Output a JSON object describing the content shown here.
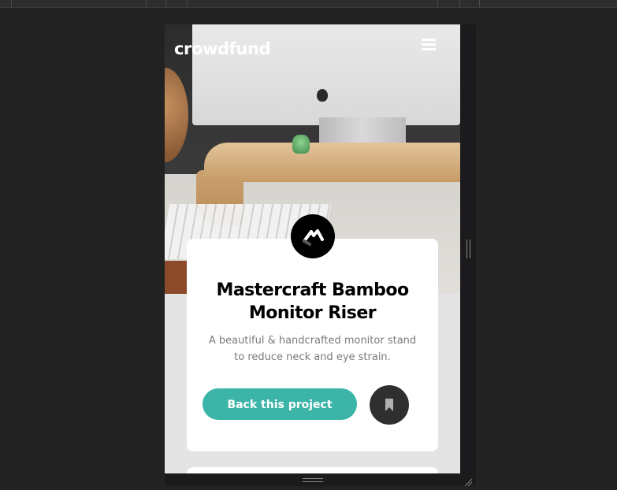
{
  "header": {
    "logo": "crowdfund",
    "menu_icon": "hamburger-menu-icon"
  },
  "hero": {
    "image_alt": "hero-image"
  },
  "card": {
    "title": "Mastercraft Bamboo Monitor Riser",
    "description": "A beautiful & handcrafted monitor stand to reduce neck and eye strain.",
    "back_button_label": "Back this project",
    "bookmark_icon": "bookmark-icon",
    "project_logo_icon": "mastercraft-logo-icon"
  },
  "colors": {
    "accent": "#3cb4a8",
    "page_bg": "#e4e4e4",
    "card_bg": "#ffffff",
    "bookmark_bg": "#2f2f2f"
  }
}
